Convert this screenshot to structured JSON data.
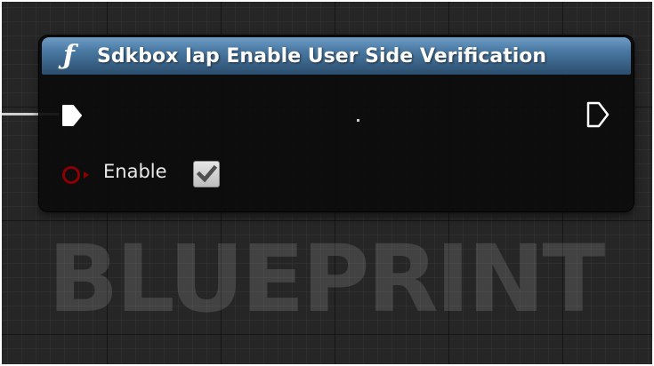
{
  "node": {
    "title": "Sdkbox Iap Enable User Side Verification",
    "function_glyph": "ƒ",
    "header_color": "#4a7aa4",
    "input": {
      "label": "Enable",
      "checked": true,
      "pin_color": "#8b0000"
    }
  },
  "watermark": "BLUEPRINT",
  "icons": {
    "exec_in": "exec-pin-filled-icon",
    "exec_out": "exec-pin-outline-icon",
    "bool_pin": "bool-pin-icon",
    "check": "checkmark-icon"
  }
}
